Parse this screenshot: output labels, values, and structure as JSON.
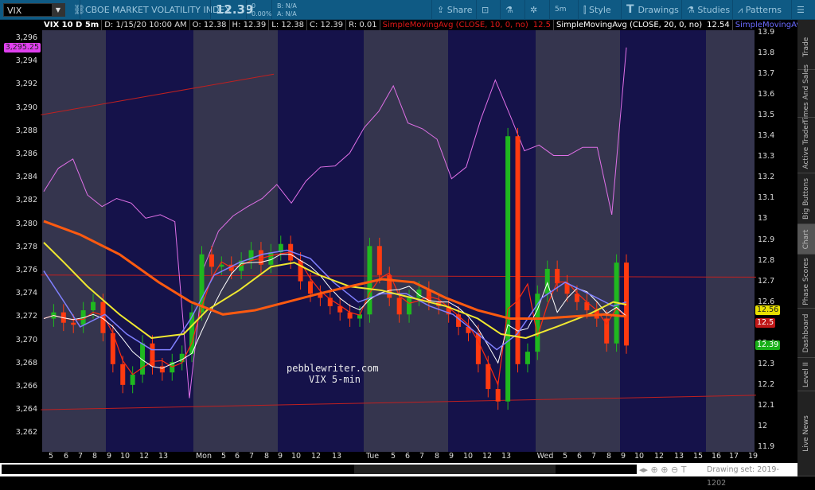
{
  "toolbar": {
    "symbol": "VIX",
    "description": "CBOE MARKET VOLATILITY INDEX",
    "last": "12.39",
    "change": "0",
    "change_pct": "0.00%",
    "bid": "B: N/A",
    "ask": "A: N/A",
    "buttons": {
      "share": "Share",
      "timeframe": "5m",
      "style": "Style",
      "drawings": "Drawings",
      "studies": "Studies",
      "patterns": "Patterns"
    }
  },
  "info": {
    "title": "VIX 10 D 5m",
    "date": "D: 1/15/20 10:00 AM",
    "open": "O: 12.38",
    "high": "H: 12.39",
    "low": "L: 12.38",
    "close": "C: 12.39",
    "range": "R: 0.01",
    "sma10_label": "SimpleMovingAvg (CLOSE, 10, 0, no)",
    "sma10_value": "12.5",
    "sma20_label": "SimpleMovingAvg (CLOSE, 20, 0, no)",
    "sma20_value": "12.54",
    "sma_other_label": "SimpleMovingAvg (CLOSE,..."
  },
  "left_axis": {
    "ticks": [
      "3,296",
      "3,294",
      "3,292",
      "3,290",
      "3,288",
      "3,286",
      "3,284",
      "3,282",
      "3,280",
      "3,278",
      "3,276",
      "3,274",
      "3,272",
      "3,270",
      "3,268",
      "3,266",
      "3,264",
      "3,262"
    ],
    "marker": "3,295.25"
  },
  "right_axis": {
    "ticks": [
      "13.9",
      "13.8",
      "13.7",
      "13.6",
      "13.5",
      "13.4",
      "13.3",
      "13.2",
      "13.1",
      "13",
      "12.9",
      "12.8",
      "12.7",
      "12.6",
      "12.5",
      "12.4",
      "12.3",
      "12.2",
      "12.1",
      "12",
      "11.9"
    ],
    "markers": [
      {
        "text": "12.56",
        "color": "#e8e000",
        "value": 12.56
      },
      {
        "text": "12.5",
        "color": "#c01818",
        "value": 12.5
      },
      {
        "text": "12.39",
        "color": "#18b018",
        "value": 12.39
      }
    ]
  },
  "time_axis": [
    "5",
    "6",
    "7",
    "8",
    "9",
    "10",
    "12",
    "13",
    "Mon",
    "5",
    "6",
    "7",
    "8",
    "9",
    "10",
    "12",
    "13",
    "Tue",
    "5",
    "6",
    "7",
    "8",
    "9",
    "10",
    "12",
    "13",
    "Wed",
    "5",
    "6",
    "7",
    "8",
    "9",
    "10",
    "12",
    "13",
    "15",
    "16",
    "17",
    "19"
  ],
  "sidebar": [
    "Trade",
    "Times And Sales",
    "Active Trader",
    "Big Buttons",
    "Chart",
    "Phase Scores",
    "Dashboard",
    "Level II",
    "Live News"
  ],
  "watermark": [
    "pebblewriter.com",
    "VIX 5-min"
  ],
  "bottom": {
    "drawing_set": "Drawing set: 2019-1202"
  },
  "colors": {
    "band_light": "#35354e",
    "band_dark": "#15124a",
    "pink": "#e070e8",
    "orange": "#ff5a10",
    "yellow": "#f0e830",
    "blue": "#8080ff",
    "up": "#1fb81f",
    "down": "#ff3a10"
  },
  "chart_data": {
    "type": "line",
    "x_note": "sample index 0-40 across session",
    "left_ylim": [
      3261,
      3297
    ],
    "right_ylim": [
      11.9,
      13.9
    ],
    "spx_compare": [
      3282.8,
      3284.8,
      3285.6,
      3282.5,
      3281.5,
      3282.2,
      3281.8,
      3280.5,
      3280.8,
      3280.2,
      3265,
      3276.3,
      3279.4,
      3280.7,
      3281.5,
      3282.2,
      3283.4,
      3281.8,
      3283.7,
      3284.9,
      3285.0,
      3286.1,
      3288.3,
      3289.7,
      3291.9,
      3288.7,
      3288.2,
      3287.3,
      3283.9,
      3284.9,
      3289.0,
      3292.4,
      3289.4,
      3286.3,
      3286.8,
      3285.9,
      3285.9,
      3286.6,
      3286.6,
      3280.8,
      3295.2
    ],
    "sma_orange": [
      [
        0,
        12.99
      ],
      [
        2.5,
        12.925
      ],
      [
        5.2,
        12.83
      ],
      [
        7.9,
        12.695
      ],
      [
        10.1,
        12.6
      ],
      [
        12.3,
        12.54
      ],
      [
        14.5,
        12.56
      ],
      [
        16.7,
        12.6
      ],
      [
        18.9,
        12.64
      ],
      [
        21,
        12.675
      ],
      [
        23.2,
        12.71
      ],
      [
        25.4,
        12.695
      ],
      [
        27.6,
        12.62
      ],
      [
        29.8,
        12.56
      ],
      [
        32,
        12.52
      ],
      [
        34.2,
        12.52
      ],
      [
        36.3,
        12.53
      ],
      [
        38.5,
        12.54
      ],
      [
        40,
        12.53
      ]
    ],
    "sma_yellow": [
      [
        0,
        12.887
      ],
      [
        1.4,
        12.79
      ],
      [
        3,
        12.675
      ],
      [
        5.2,
        12.54
      ],
      [
        7.4,
        12.426
      ],
      [
        9.6,
        12.445
      ],
      [
        11.2,
        12.56
      ],
      [
        13.4,
        12.656
      ],
      [
        15.6,
        12.77
      ],
      [
        17.2,
        12.79
      ],
      [
        18.8,
        12.733
      ],
      [
        21,
        12.675
      ],
      [
        23.2,
        12.656
      ],
      [
        25.4,
        12.618
      ],
      [
        27.6,
        12.58
      ],
      [
        29.8,
        12.52
      ],
      [
        31.4,
        12.445
      ],
      [
        33.1,
        12.426
      ],
      [
        35.3,
        12.483
      ],
      [
        37.4,
        12.54
      ],
      [
        39.1,
        12.6
      ],
      [
        40,
        12.587
      ]
    ],
    "sma_blue": [
      [
        0,
        12.75
      ],
      [
        1.4,
        12.6
      ],
      [
        2.5,
        12.48
      ],
      [
        4.2,
        12.54
      ],
      [
        5.7,
        12.445
      ],
      [
        7.4,
        12.37
      ],
      [
        8.7,
        12.37
      ],
      [
        10.1,
        12.52
      ],
      [
        11.7,
        12.73
      ],
      [
        13.4,
        12.79
      ],
      [
        15,
        12.83
      ],
      [
        16.7,
        12.85
      ],
      [
        18.3,
        12.81
      ],
      [
        19.9,
        12.695
      ],
      [
        21.6,
        12.6
      ],
      [
        23.2,
        12.64
      ],
      [
        24.9,
        12.64
      ],
      [
        26.5,
        12.58
      ],
      [
        28.1,
        12.54
      ],
      [
        29.8,
        12.445
      ],
      [
        31.1,
        12.37
      ],
      [
        32.5,
        12.445
      ],
      [
        34.2,
        12.62
      ],
      [
        35.8,
        12.695
      ],
      [
        37.4,
        12.64
      ],
      [
        39.1,
        12.58
      ],
      [
        40,
        12.6
      ]
    ],
    "closes": [
      12.52,
      12.55,
      12.5,
      12.49,
      12.56,
      12.6,
      12.45,
      12.3,
      12.2,
      12.25,
      12.4,
      12.29,
      12.26,
      12.31,
      12.35,
      12.55,
      12.83,
      12.77,
      12.78,
      12.75,
      12.8,
      12.85,
      12.78,
      12.84,
      12.88,
      12.8,
      12.7,
      12.64,
      12.62,
      12.58,
      12.55,
      12.52,
      12.54,
      12.87,
      12.73,
      12.62,
      12.54,
      12.62,
      12.66,
      12.6,
      12.58,
      12.54,
      12.48,
      12.45,
      12.3,
      12.18,
      12.12,
      13.4,
      12.3,
      12.36,
      12.64,
      12.76,
      12.69,
      12.64,
      12.6,
      12.56,
      12.52,
      12.4,
      12.79,
      12.39
    ],
    "trendlines": [
      {
        "scale": "left",
        "from": [
          -0.2,
          3289.4
        ],
        "to": [
          15.8,
          3292.9
        ]
      },
      {
        "scale": "right",
        "from": [
          -0.2,
          12.73
        ],
        "to": [
          48.9,
          12.72
        ]
      },
      {
        "scale": "right",
        "from": [
          -0.2,
          12.08
        ],
        "to": [
          48.9,
          12.15
        ]
      }
    ]
  }
}
